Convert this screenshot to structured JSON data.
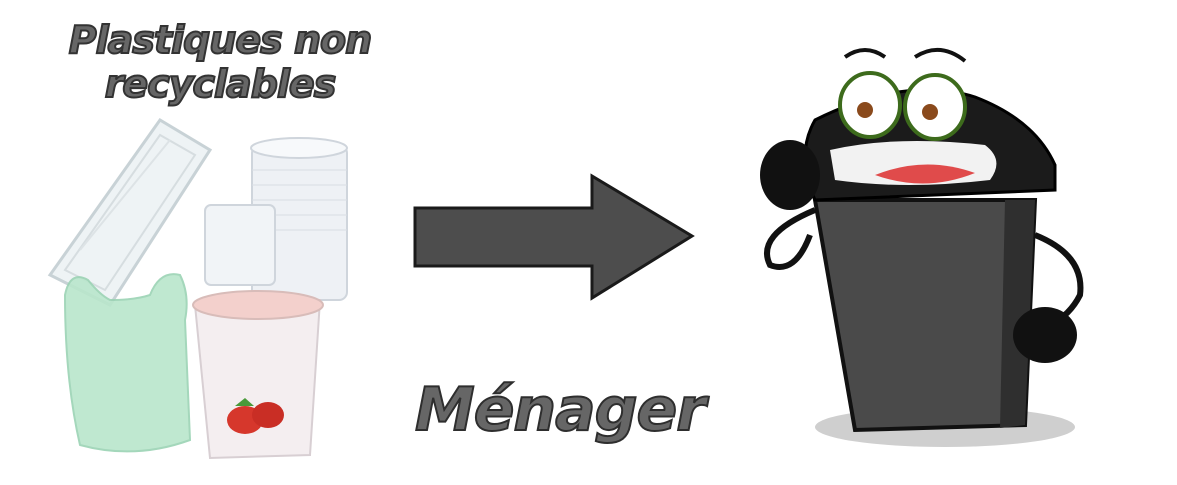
{
  "title": "Plastiques non recyclables",
  "label": "Ménager",
  "colors": {
    "arrow": "#4d4d4d",
    "bin": "#4a4a4a",
    "text": "#666666"
  },
  "icons": [
    "plastic-items-illustration",
    "right-arrow-icon",
    "trash-bin-mascot"
  ]
}
